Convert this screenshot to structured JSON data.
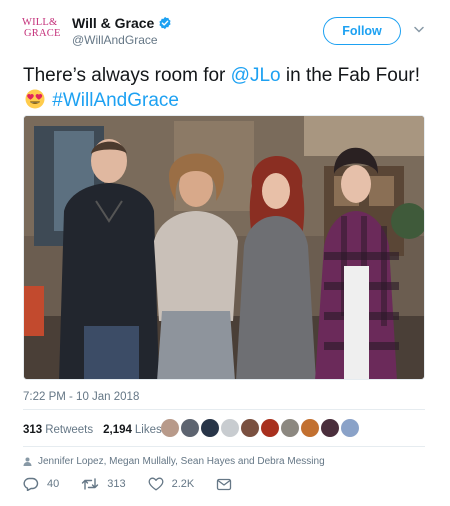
{
  "account": {
    "logo_line1": "WILL&",
    "logo_line2": "GRACE",
    "display_name": "Will & Grace",
    "handle": "@WillAndGrace",
    "follow_label": "Follow"
  },
  "tweet": {
    "text_part1": "There’s always room for ",
    "mention": "@JLo",
    "text_part2": " in the Fab Four! ",
    "emoji": "heart-eyes-emoji",
    "hashtag": "#WillAndGrace"
  },
  "timestamp": "7:22 PM - 10 Jan 2018",
  "stats": {
    "retweets_count": "313",
    "retweets_label": "Retweets",
    "likes_count": "2,194",
    "likes_label": "Likes"
  },
  "tagged_people": "Jennifer Lopez, Megan Mullally, Sean Hayes and Debra Messing",
  "actions": {
    "replies": "40",
    "retweets": "313",
    "likes": "2.2K"
  },
  "colors": {
    "brand_blue": "#1da1f2",
    "logo_pink": "#c4307a",
    "text_primary": "#14171a",
    "text_secondary": "#657786"
  }
}
